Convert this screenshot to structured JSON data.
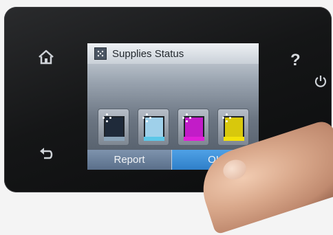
{
  "screen": {
    "title": "Supplies Status",
    "title_icon": "supplies-icon",
    "cartridges": [
      {
        "name": "black",
        "color": "#1f2a3a",
        "fill": "#8aa3b8"
      },
      {
        "name": "cyan",
        "color": "#9fd0ea",
        "fill": "#5cc7e8"
      },
      {
        "name": "magenta",
        "color": "#c21cc8",
        "fill": "#e020d8"
      },
      {
        "name": "yellow",
        "color": "#d8c80c",
        "fill": "#f2e10a"
      }
    ],
    "buttons": {
      "report_label": "Report",
      "ok_label": "OK"
    }
  },
  "bezel": {
    "home_icon": "home-icon",
    "back_icon": "back-icon",
    "help_icon": "help-icon",
    "power_icon": "power-icon",
    "help_text": "?"
  }
}
